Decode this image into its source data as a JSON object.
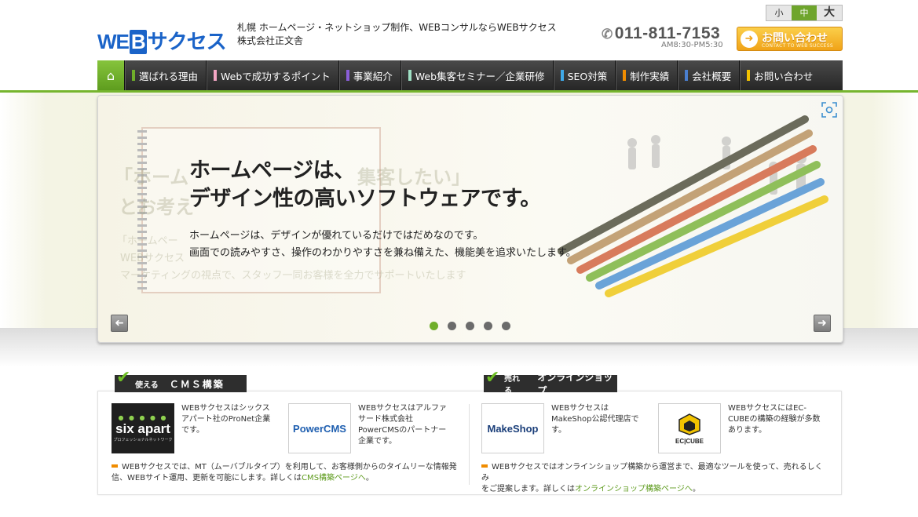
{
  "header": {
    "logo": {
      "prefix": "WE",
      "mark": "B",
      "suffix": "サクセス"
    },
    "tagline_line1": "札幌 ホームページ・ネットショップ制作、WEBコンサルならWEBサクセス",
    "tagline_line2": "株式会社正文舎",
    "font_size": {
      "small": "小",
      "medium": "中",
      "large": "大",
      "selected": "中"
    },
    "phone": "011-811-7153",
    "hours": "AM8:30-PM5:30",
    "contact_button": {
      "label": "お問い合わせ",
      "sub": "CONTACT TO WEB SUCCESS"
    }
  },
  "nav": {
    "home_icon": "home-icon",
    "items": [
      {
        "label": "選ばれる理由",
        "color": "#6fae2a"
      },
      {
        "label": "Webで成功するポイント",
        "color": "#f4a6c4"
      },
      {
        "label": "事業紹介",
        "color": "#8a5ed8"
      },
      {
        "label": "Web集客セミナー／企業研修",
        "color": "#9fe0c4"
      },
      {
        "label": "SEO対策",
        "color": "#3fa9e8"
      },
      {
        "label": "制作実績",
        "color": "#f08c00"
      },
      {
        "label": "会社概要",
        "color": "#4a7fd0"
      },
      {
        "label": "お問い合わせ",
        "color": "#f2c200"
      }
    ]
  },
  "hero": {
    "headline_line1": "ホームページは、",
    "headline_line2": "デザイン性の高いソフトウェアです。",
    "body_line1": "ホームページは、デザインが優れているだけではだめなのです。",
    "body_line2": "画面での読みやすさ、操作のわかりやすさを兼ね備えた、機能美を追求いたします。",
    "ghost_line1": "「ホーム",
    "ghost_line1b": "集客したい」",
    "ghost_line2": "とお考え",
    "ghost_small1": "「ホームペー",
    "ghost_small2": "WEBサクセス",
    "ghost_small3": "マーケティングの視点で、スタッフ一同お客様を全力でサポートいたします",
    "slide_count": 5,
    "active_slide": 1,
    "prev_icon": "arrow-left-icon",
    "next_icon": "arrow-right-icon",
    "expand_icon": "expand-icon"
  },
  "cms": {
    "lead": "使える",
    "title": "ＣＭＳ構築",
    "sixapart_logo": "six apart",
    "sixapart_sub": "プロフェッショナルネットワーク",
    "sixapart_text": "WEBサクセスはシックスアパート社のProNet企業です。",
    "powercms_logo": "PowerCMS",
    "powercms_text": "WEBサクセスはアルファサード株式会社PowerCMSのパートナー企業です。",
    "note_line1": "WEBサクセスでは、MT（ムーバブルタイプ）を利用して、お客様側からのタイムリーな情報発",
    "note_line2_pre": "信、WEBサイト運用、更新を可能にします。詳しくは",
    "note_link": "CMS構築ページへ",
    "note_line2_post": "。"
  },
  "shop": {
    "lead": "売れる",
    "title": "オンラインショップ",
    "makeshop_logo": "MakeShop",
    "makeshop_text": "WEBサクセスはMakeShop公認代理店です。",
    "eccube_logo": "EC|CUBE",
    "eccube_text": "WEBサクセスにはEC-CUBEの構築の経験が多数あります。",
    "note_line1": "WEBサクセスではオンラインショップ構築から運営まで、最適なツールを使って、売れるしくみ",
    "note_line2_pre": "をご提案します。詳しくは",
    "note_link": "オンラインショップ構築ページへ",
    "note_line2_post": "。"
  }
}
